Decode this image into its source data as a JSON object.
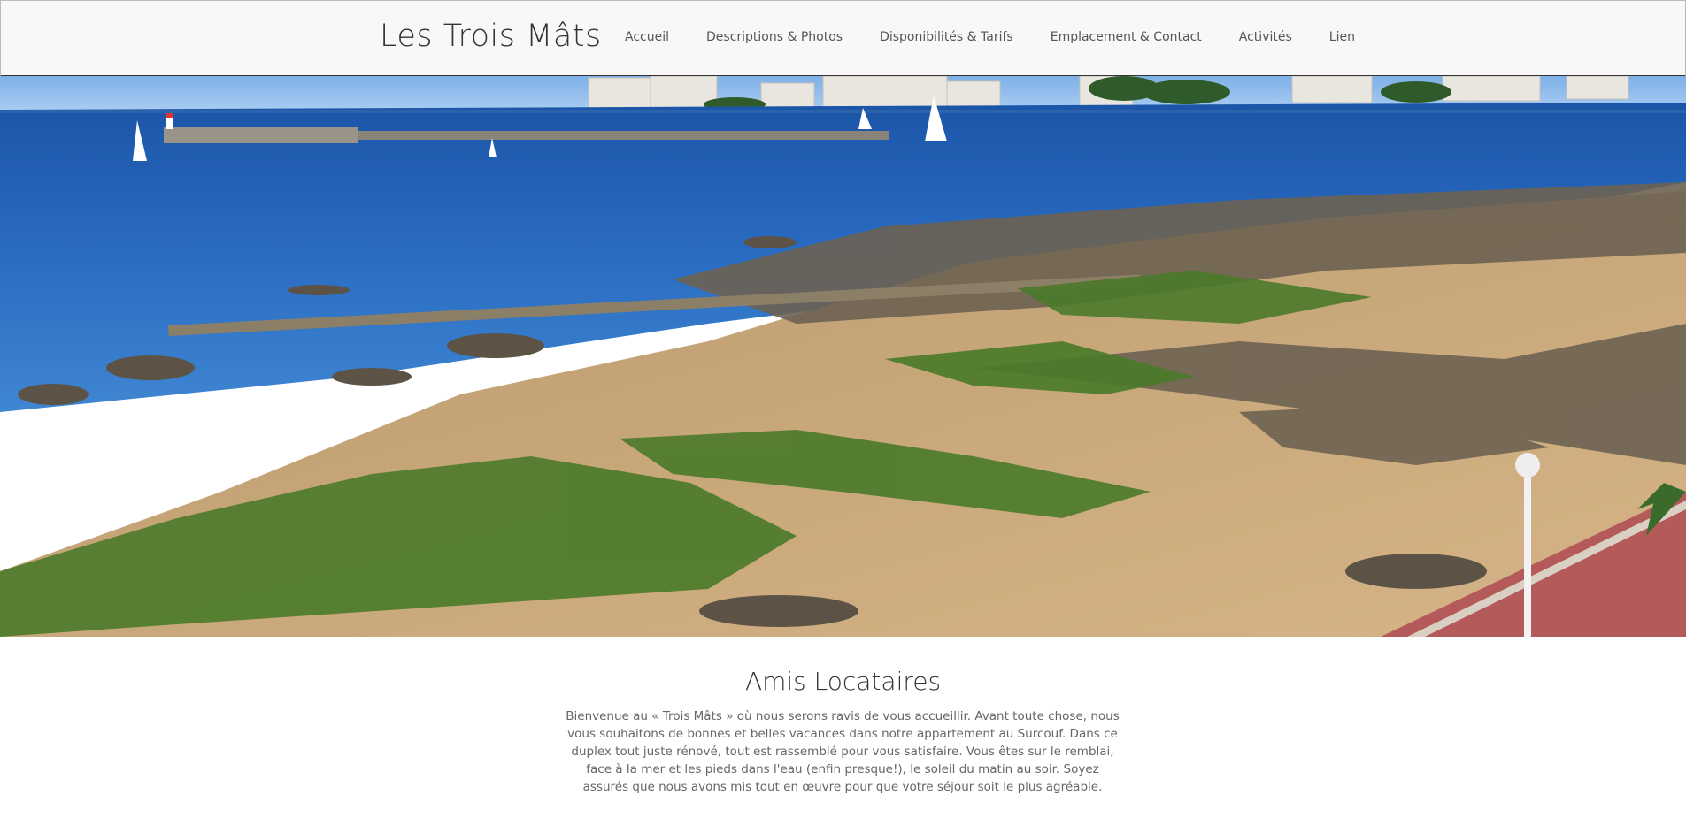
{
  "header": {
    "brand": "Les Trois Mâts",
    "nav": [
      {
        "label": "Accueil"
      },
      {
        "label": "Descriptions & Photos"
      },
      {
        "label": "Disponibilités & Tarifs"
      },
      {
        "label": "Emplacement & Contact"
      },
      {
        "label": "Activités"
      },
      {
        "label": "Lien"
      }
    ]
  },
  "hero": {
    "description_icon": "beach-photo-image"
  },
  "main": {
    "title": "Amis Locataires",
    "intro": "Bienvenue au « Trois Mâts » où nous serons ravis de vous accueillir. Avant toute chose, nous vous souhaitons de bonnes et belles vacances dans notre appartement au Surcouf. Dans ce duplex tout juste rénové, tout est rassemblé pour vous satisfaire. Vous êtes sur le remblai, face à la mer et les pieds dans l'eau (enfin presque!), le soleil du matin au soir. Soyez assurés que nous avons mis tout en œuvre pour que votre séjour soit le plus agréable."
  },
  "colors": {
    "header_bg": "#f8f8f8",
    "text": "#555555",
    "sea": "#1f5fb0",
    "sand": "#c9a77a",
    "algae": "#4a7a2a"
  }
}
